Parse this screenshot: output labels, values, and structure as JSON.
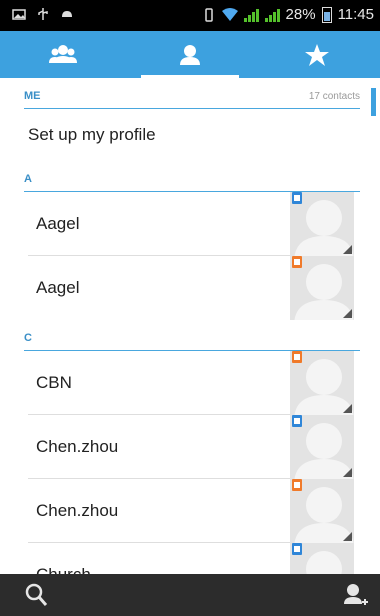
{
  "statusbar": {
    "battery_percent": "28%",
    "time": "11:45",
    "left_icons": [
      "picture-icon",
      "usb-icon",
      "android-icon"
    ],
    "right_icons": [
      "vibrate-icon",
      "wifi-icon",
      "signal-icon",
      "signal-icon",
      "battery-icon"
    ]
  },
  "tabs": [
    {
      "icon": "groups-icon",
      "active": false
    },
    {
      "icon": "contacts-icon",
      "active": true
    },
    {
      "icon": "favorites-star-icon",
      "active": false
    }
  ],
  "sections": {
    "me": {
      "title": "ME",
      "count": "17 contacts"
    },
    "profile_label": "Set up my profile",
    "a": {
      "title": "A"
    },
    "c": {
      "title": "C"
    }
  },
  "contacts": [
    {
      "name": "Aagel",
      "badge_color": "#2f86d8"
    },
    {
      "name": "Aagel",
      "badge_color": "#f07a2a"
    },
    {
      "name": "CBN",
      "badge_color": "#f07a2a"
    },
    {
      "name": "Chen.zhou",
      "badge_color": "#2f86d8"
    },
    {
      "name": "Chen.zhou",
      "badge_color": "#f07a2a"
    },
    {
      "name": "Church",
      "badge_color": "#2f86d8"
    }
  ],
  "bottombar": {
    "left_icon": "search-icon",
    "right_icon": "add-contact-icon"
  },
  "colors": {
    "accent": "#3da1df",
    "bottombar": "#2c2c2c"
  }
}
